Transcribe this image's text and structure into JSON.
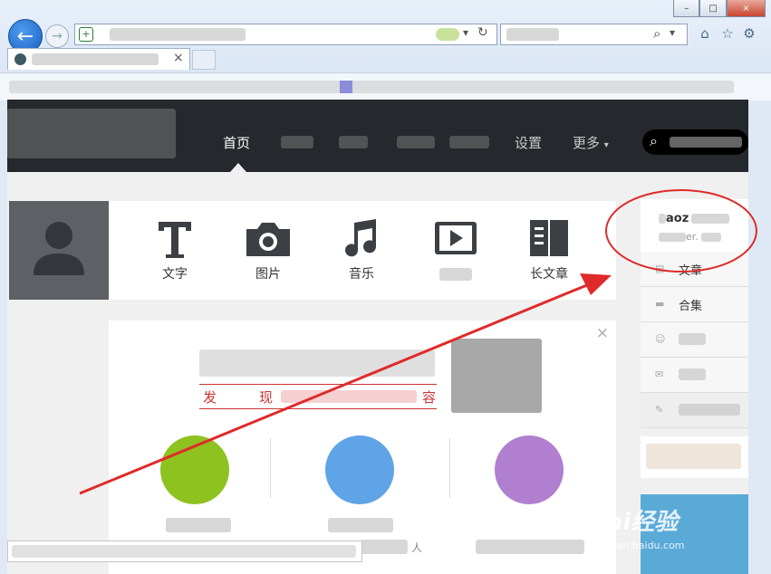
{
  "browser": {
    "window_controls": [
      "–",
      "□",
      "×"
    ],
    "back_icon": "back-arrow-icon",
    "forward_icon": "forward-arrow-icon"
  },
  "nav": {
    "home": "首页",
    "settings": "设置",
    "more": "更多"
  },
  "post_types": [
    {
      "icon": "text-icon",
      "label": "文字"
    },
    {
      "icon": "camera-icon",
      "label": "图片"
    },
    {
      "icon": "music-note-icon",
      "label": "音乐"
    },
    {
      "icon": "video-play-icon",
      "label": ""
    },
    {
      "icon": "long-article-icon",
      "label": "长文章"
    }
  ],
  "sidebar": {
    "user_name_fragment": "aoz",
    "user_sub_fragment": "er.",
    "items": [
      {
        "icon": "article-list-icon",
        "label": "文章"
      },
      {
        "icon": "folder-icon",
        "label": "合集"
      }
    ]
  },
  "card": {
    "close": "×",
    "headline_fragment_start": "发",
    "headline_fragment_mid": "现",
    "headline_fragment_end": "容",
    "bottom_fragment": "人"
  },
  "watermark": {
    "text": "Bai经验",
    "sub": "jingyan.baidu.com"
  },
  "colors": {
    "nav_bg": "#25282c",
    "annotation_red": "#e02a2a",
    "circle_green": "#8dc21f",
    "circle_blue": "#5fa4e6",
    "circle_purple": "#b07fcf"
  }
}
